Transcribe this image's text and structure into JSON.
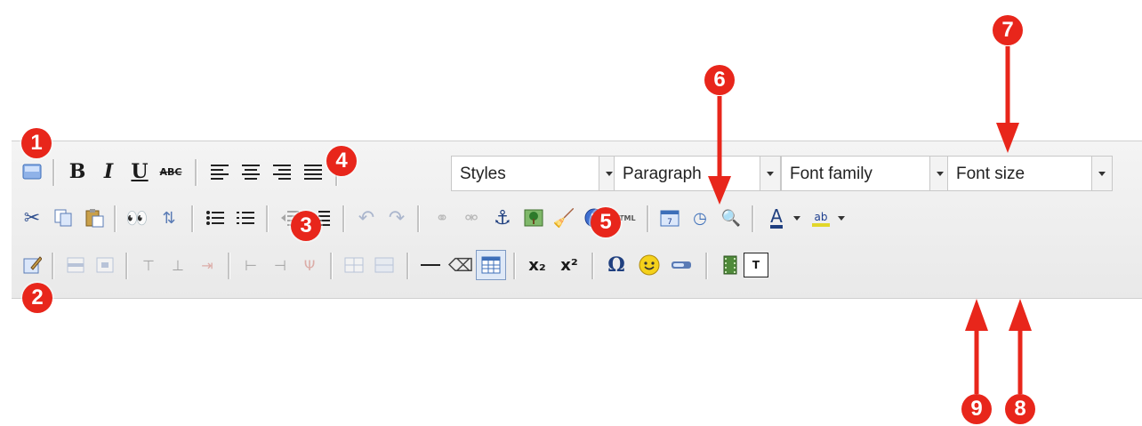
{
  "colors": {
    "marker": "#e8261b",
    "toolbar_bg": "#ededed",
    "select_bg": "#ffffff"
  },
  "toolbar": {
    "selects": {
      "styles": "Styles",
      "paragraph": "Paragraph",
      "font_family": "Font family",
      "font_size": "Font size"
    },
    "row1_buttons": [
      "toggle-toolbar-icon",
      "bold-icon",
      "italic-icon",
      "underline-icon",
      "strikethrough-icon",
      "align-left-icon",
      "align-center-icon",
      "align-right-icon",
      "align-justify-icon"
    ],
    "row2_buttons": [
      "cut-icon",
      "copy-icon",
      "paste-icon",
      "find-icon",
      "replace-icon",
      "bullet-list-icon",
      "numbered-list-icon",
      "outdent-icon",
      "indent-icon",
      "undo-icon",
      "redo-icon",
      "link-icon",
      "unlink-icon",
      "anchor-icon",
      "image-icon",
      "cleanup-icon",
      "help-icon",
      "html-icon",
      "insert-date-icon",
      "insert-time-icon",
      "preview-icon",
      "text-color-icon",
      "background-color-icon"
    ],
    "row3_buttons": [
      "edit-icon",
      "table-row-icons",
      "table-col-icons",
      "horizontal-rule-icon",
      "remove-format-icon",
      "table-icon",
      "subscript-icon",
      "superscript-icon",
      "special-char-icon",
      "emoticon-icon",
      "layer-icon",
      "media-icon",
      "text-template-icon"
    ],
    "glyphs": {
      "bold": "B",
      "italic": "I",
      "underline": "U",
      "strike": "ABC",
      "html": "HTML",
      "omega": "Ω",
      "sub": "x₂",
      "sup": "x²",
      "text_a": "A",
      "t_box": "T"
    }
  },
  "markers": [
    "1",
    "2",
    "3",
    "4",
    "5",
    "6",
    "7",
    "8",
    "9"
  ]
}
